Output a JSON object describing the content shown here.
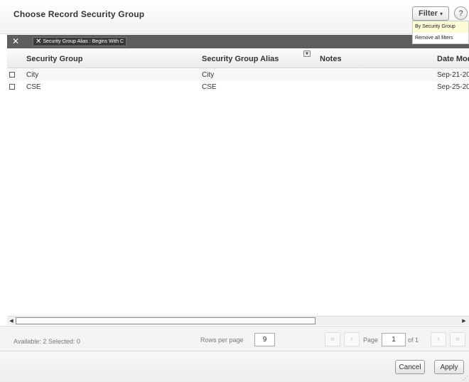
{
  "dialog": {
    "title": "Choose Record Security Group"
  },
  "toolbar": {
    "filter_label": "Filter",
    "filter_caret": "▾",
    "help_label": "?"
  },
  "filter_menu": {
    "items": [
      {
        "label": "By Security Group",
        "active": true
      },
      {
        "label": "Remove all filters",
        "active": false
      }
    ]
  },
  "active_filters": {
    "clear_all": "✕",
    "chips": [
      {
        "remove": "✕",
        "label": "Security Group Alias : Begins With C"
      }
    ]
  },
  "grid": {
    "columns": [
      {
        "label": "Security Group"
      },
      {
        "label": "Security Group Alias",
        "filtered": true
      },
      {
        "label": "Notes"
      },
      {
        "label": "Date Mod"
      }
    ],
    "rows": [
      {
        "security_group": "City",
        "alias": "City",
        "notes": "",
        "date": "Sep-21-20"
      },
      {
        "security_group": "CSE",
        "alias": "CSE",
        "notes": "",
        "date": "Sep-25-20"
      }
    ]
  },
  "scrollbar": {
    "left_arrow": "◀",
    "right_arrow": "▶"
  },
  "status": {
    "summary": "Available: 2 Selected: 0",
    "rows_per_page_label": "Rows per page",
    "rows_per_page_value": "9",
    "page_label": "Page",
    "page_value": "1",
    "of_label": "of 1",
    "first_icon": "«",
    "prev_icon": "‹",
    "next_icon": "›",
    "last_icon": "»"
  },
  "footer": {
    "cancel_label": "Cancel",
    "apply_label": "Apply"
  },
  "colors": {
    "filterbar": "#5e5e5e",
    "menu_highlight": "#fdfbd6"
  }
}
